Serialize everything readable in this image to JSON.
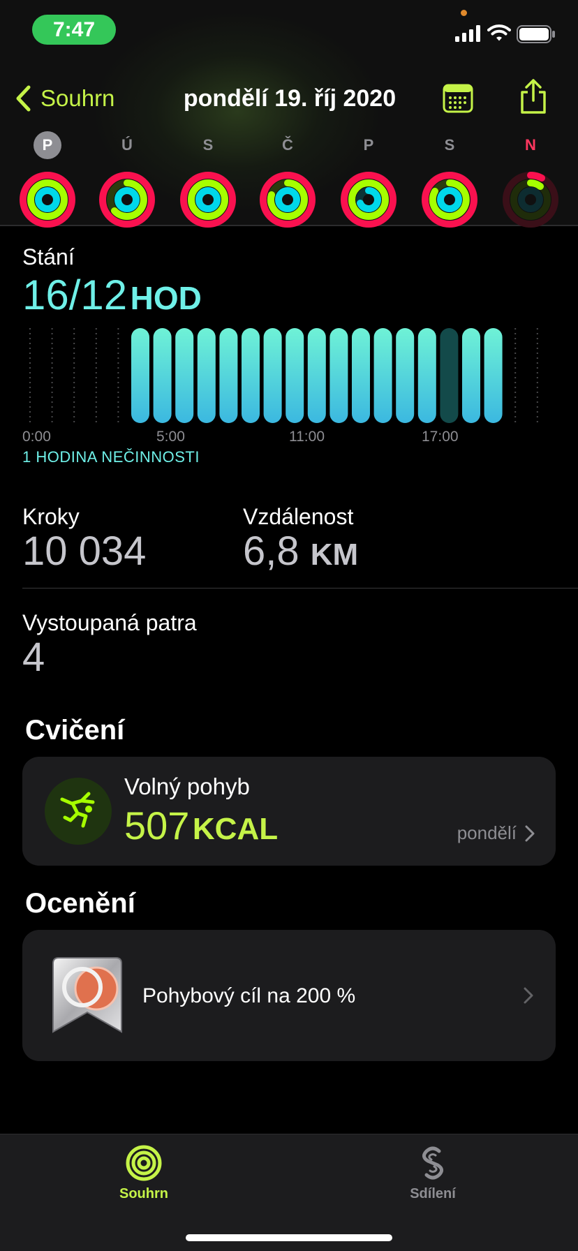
{
  "status": {
    "time": "7:47"
  },
  "nav": {
    "back_label": "Souhrn",
    "title": "pondělí 19. říj 2020"
  },
  "colors": {
    "move": "#fa114f",
    "exercise": "#a6ff00",
    "stand": "#00f0e8",
    "accent": "#c5f348"
  },
  "week": [
    {
      "letter": "P",
      "selected": true
    },
    {
      "letter": "Ú"
    },
    {
      "letter": "S"
    },
    {
      "letter": "Č"
    },
    {
      "letter": "P"
    },
    {
      "letter": "S"
    },
    {
      "letter": "N",
      "sunday": true
    }
  ],
  "stand": {
    "label": "Stání",
    "value": "16/12",
    "unit": "HOD",
    "hour_labels": [
      "0:00",
      "5:00",
      "11:00",
      "17:00"
    ],
    "inactive_note": "1 HODINA NEČINNOSTI"
  },
  "chart_data": {
    "type": "bar",
    "categories": [
      "0",
      "1",
      "2",
      "3",
      "4",
      "5",
      "6",
      "7",
      "8",
      "9",
      "10",
      "11",
      "12",
      "13",
      "14",
      "15",
      "16",
      "17",
      "18",
      "19",
      "20",
      "21",
      "22",
      "23"
    ],
    "values": [
      0,
      0,
      0,
      0,
      0,
      1,
      1,
      1,
      1,
      1,
      1,
      1,
      1,
      1,
      1,
      1,
      1,
      1,
      1,
      0,
      1,
      1,
      0,
      0
    ],
    "hourly_status": [
      "none",
      "none",
      "none",
      "none",
      "none",
      "stood",
      "stood",
      "stood",
      "stood",
      "stood",
      "stood",
      "stood",
      "stood",
      "stood",
      "stood",
      "stood",
      "stood",
      "stood",
      "stood",
      "inactive",
      "stood",
      "stood",
      "none",
      "none"
    ],
    "ylim": [
      0,
      1
    ]
  },
  "stats": {
    "steps_label": "Kroky",
    "steps_value": "10 034",
    "distance_label": "Vzdálenost",
    "distance_value": "6,8",
    "distance_unit": "KM",
    "floors_label": "Vystoupaná patra",
    "floors_value": "4"
  },
  "workouts": {
    "title": "Cvičení",
    "item": {
      "name": "Volný pohyb",
      "value": "507",
      "unit": "KCAL",
      "day": "pondělí",
      "icon": "free-movement-icon"
    }
  },
  "awards": {
    "title": "Ocenění",
    "item": {
      "label": "Pohybový cíl na 200 %",
      "icon": "move-goal-badge"
    }
  },
  "tabs": [
    {
      "label": "Souhrn",
      "icon": "activity-rings-icon",
      "active": true
    },
    {
      "label": "Sdílení",
      "icon": "sharing-icon",
      "active": false
    }
  ]
}
